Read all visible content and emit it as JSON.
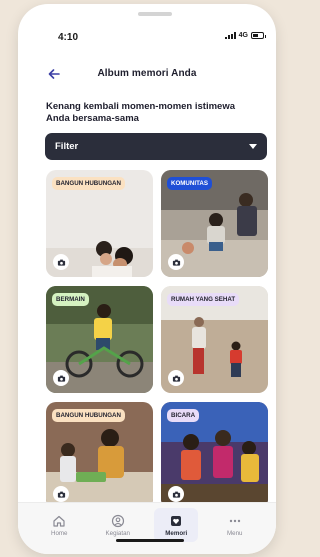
{
  "status_bar": {
    "time": "4:10",
    "network": "4G"
  },
  "header": {
    "title": "Album memori Anda"
  },
  "subtitle": "Kenang kembali momen-momen istimewa Anda bersama-sama",
  "filter": {
    "label": "Filter"
  },
  "cards": [
    {
      "tag": "BANGUN HUBUNGAN",
      "tag_color": "#fbe1c1"
    },
    {
      "tag": "KOMUNITAS",
      "tag_color": "#1f4fd6"
    },
    {
      "tag": "BERMAIN",
      "tag_color": "#d5f2c1"
    },
    {
      "tag": "RUMAH YANG SEHAT",
      "tag_color": "#e8dcf8"
    },
    {
      "tag": "BANGUN HUBUNGAN",
      "tag_color": "#fbe1c1"
    },
    {
      "tag": "BICARA",
      "tag_color": "#e8dcf8"
    }
  ],
  "bottom_nav": [
    {
      "label": "Home",
      "icon": "house-icon"
    },
    {
      "label": "Kegiatan",
      "icon": "person-circle-icon"
    },
    {
      "label": "Memori",
      "icon": "heart-frame-icon",
      "active": true
    },
    {
      "label": "Menu",
      "icon": "dots-icon"
    }
  ],
  "colors": {
    "accent": "#2b2e3b",
    "background": "#efe6da"
  }
}
